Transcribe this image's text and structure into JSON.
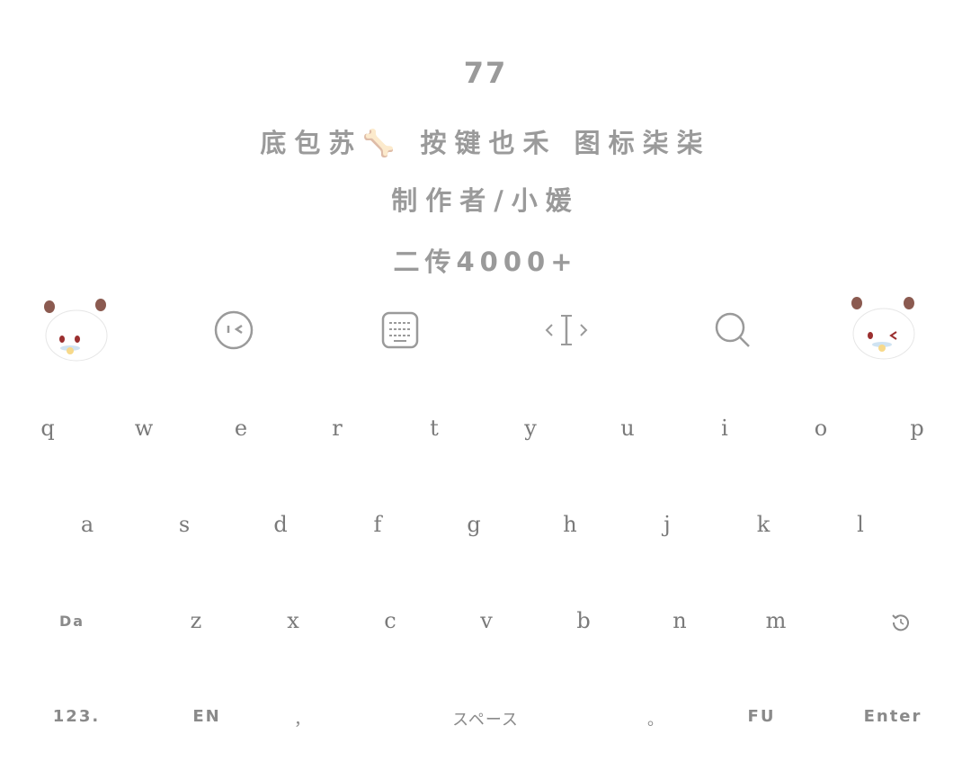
{
  "header": {
    "number": "77",
    "line1": "底包苏🦴 按键也禾 图标柒柒",
    "line2": "制作者/小媛",
    "line3": "二传4000+"
  },
  "toolbar": {
    "items": [
      "mascot-left-icon",
      "emoji-face-icon",
      "keyboard-icon",
      "cursor-move-icon",
      "search-icon",
      "mascot-right-icon"
    ],
    "mascot_ear_color": "#8b5a50",
    "mascot_eye_color": "#9b2f2f"
  },
  "keyboard": {
    "row1": [
      "q",
      "w",
      "e",
      "r",
      "t",
      "y",
      "u",
      "i",
      "o",
      "p"
    ],
    "row2": [
      "a",
      "s",
      "d",
      "f",
      "g",
      "h",
      "j",
      "k",
      "l"
    ],
    "row3": {
      "shift": "Da",
      "keys": [
        "z",
        "x",
        "c",
        "v",
        "b",
        "n",
        "m"
      ],
      "delete_icon": "undo-delete-icon"
    },
    "row4": {
      "numbers": "123.",
      "lang": "EN",
      "comma": "，",
      "space": "スペース",
      "period": "。",
      "fu": "FU",
      "enter": "Enter"
    }
  }
}
